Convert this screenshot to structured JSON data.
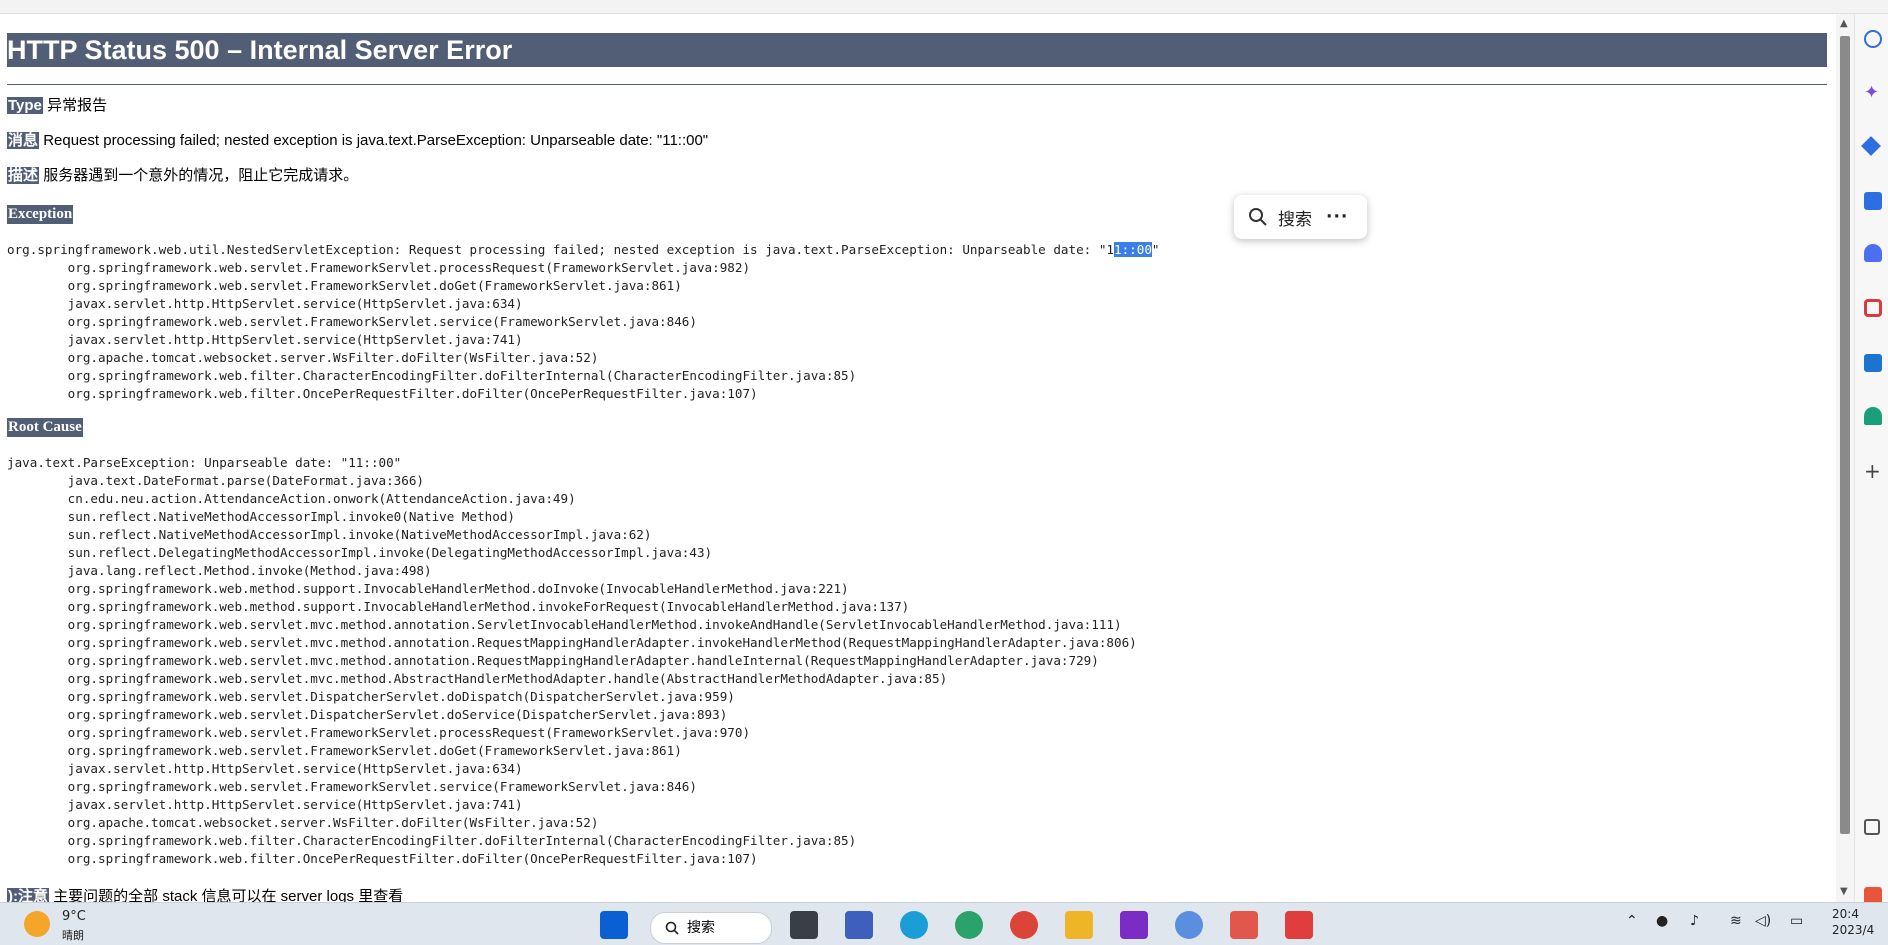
{
  "page": {
    "title": "HTTP Status 500 – Internal Server Error",
    "type_label": "Type",
    "type_value": "异常报告",
    "message_label": "消息",
    "message_value": "Request processing failed; nested exception is java.text.ParseException: Unparseable date: \"11::00\"",
    "description_label": "描述",
    "description_value": "服务器遇到一个意外的情况，阻止它完成请求。",
    "exception_heading": "Exception",
    "exception_first_prefix": "org.springframework.web.util.NestedServletException: Request processing failed; nested exception is java.text.ParseException: Unparseable date: \"1",
    "exception_first_selected": "1::00",
    "exception_first_suffix": "\"",
    "exception_trace": "        org.springframework.web.servlet.FrameworkServlet.processRequest(FrameworkServlet.java:982)\n        org.springframework.web.servlet.FrameworkServlet.doGet(FrameworkServlet.java:861)\n        javax.servlet.http.HttpServlet.service(HttpServlet.java:634)\n        org.springframework.web.servlet.FrameworkServlet.service(FrameworkServlet.java:846)\n        javax.servlet.http.HttpServlet.service(HttpServlet.java:741)\n        org.apache.tomcat.websocket.server.WsFilter.doFilter(WsFilter.java:52)\n        org.springframework.web.filter.CharacterEncodingFilter.doFilterInternal(CharacterEncodingFilter.java:85)\n        org.springframework.web.filter.OncePerRequestFilter.doFilter(OncePerRequestFilter.java:107)",
    "root_cause_heading": "Root Cause",
    "root_cause_trace": "java.text.ParseException: Unparseable date: \"11::00\"\n        java.text.DateFormat.parse(DateFormat.java:366)\n        cn.edu.neu.action.AttendanceAction.onwork(AttendanceAction.java:49)\n        sun.reflect.NativeMethodAccessorImpl.invoke0(Native Method)\n        sun.reflect.NativeMethodAccessorImpl.invoke(NativeMethodAccessorImpl.java:62)\n        sun.reflect.DelegatingMethodAccessorImpl.invoke(DelegatingMethodAccessorImpl.java:43)\n        java.lang.reflect.Method.invoke(Method.java:498)\n        org.springframework.web.method.support.InvocableHandlerMethod.doInvoke(InvocableHandlerMethod.java:221)\n        org.springframework.web.method.support.InvocableHandlerMethod.invokeForRequest(InvocableHandlerMethod.java:137)\n        org.springframework.web.servlet.mvc.method.annotation.ServletInvocableHandlerMethod.invokeAndHandle(ServletInvocableHandlerMethod.java:111)\n        org.springframework.web.servlet.mvc.method.annotation.RequestMappingHandlerAdapter.invokeHandlerMethod(RequestMappingHandlerAdapter.java:806)\n        org.springframework.web.servlet.mvc.method.annotation.RequestMappingHandlerAdapter.handleInternal(RequestMappingHandlerAdapter.java:729)\n        org.springframework.web.servlet.mvc.method.AbstractHandlerMethodAdapter.handle(AbstractHandlerMethodAdapter.java:85)\n        org.springframework.web.servlet.DispatcherServlet.doDispatch(DispatcherServlet.java:959)\n        org.springframework.web.servlet.DispatcherServlet.doService(DispatcherServlet.java:893)\n        org.springframework.web.servlet.FrameworkServlet.processRequest(FrameworkServlet.java:970)\n        org.springframework.web.servlet.FrameworkServlet.doGet(FrameworkServlet.java:861)\n        javax.servlet.http.HttpServlet.service(HttpServlet.java:634)\n        org.springframework.web.servlet.FrameworkServlet.service(FrameworkServlet.java:846)\n        javax.servlet.http.HttpServlet.service(HttpServlet.java:741)\n        org.apache.tomcat.websocket.server.WsFilter.doFilter(WsFilter.java:52)\n        org.springframework.web.filter.CharacterEncodingFilter.doFilterInternal(CharacterEncodingFilter.java:85)\n        org.springframework.web.filter.OncePerRequestFilter.doFilter(OncePerRequestFilter.java:107)",
    "note_label": "):注意",
    "note_value": "主要问题的全部 stack 信息可以在 server logs 里查看"
  },
  "selection_popup": {
    "search_label": "搜索",
    "more_label": "···"
  },
  "taskbar": {
    "weather_temp": "9°C",
    "weather_desc": "晴朗",
    "search_label": "搜索",
    "clock_time": "20:4",
    "clock_date": "2023/4"
  },
  "colors": {
    "tomcat_header": "#525d76",
    "selection": "#3b7ee6"
  }
}
